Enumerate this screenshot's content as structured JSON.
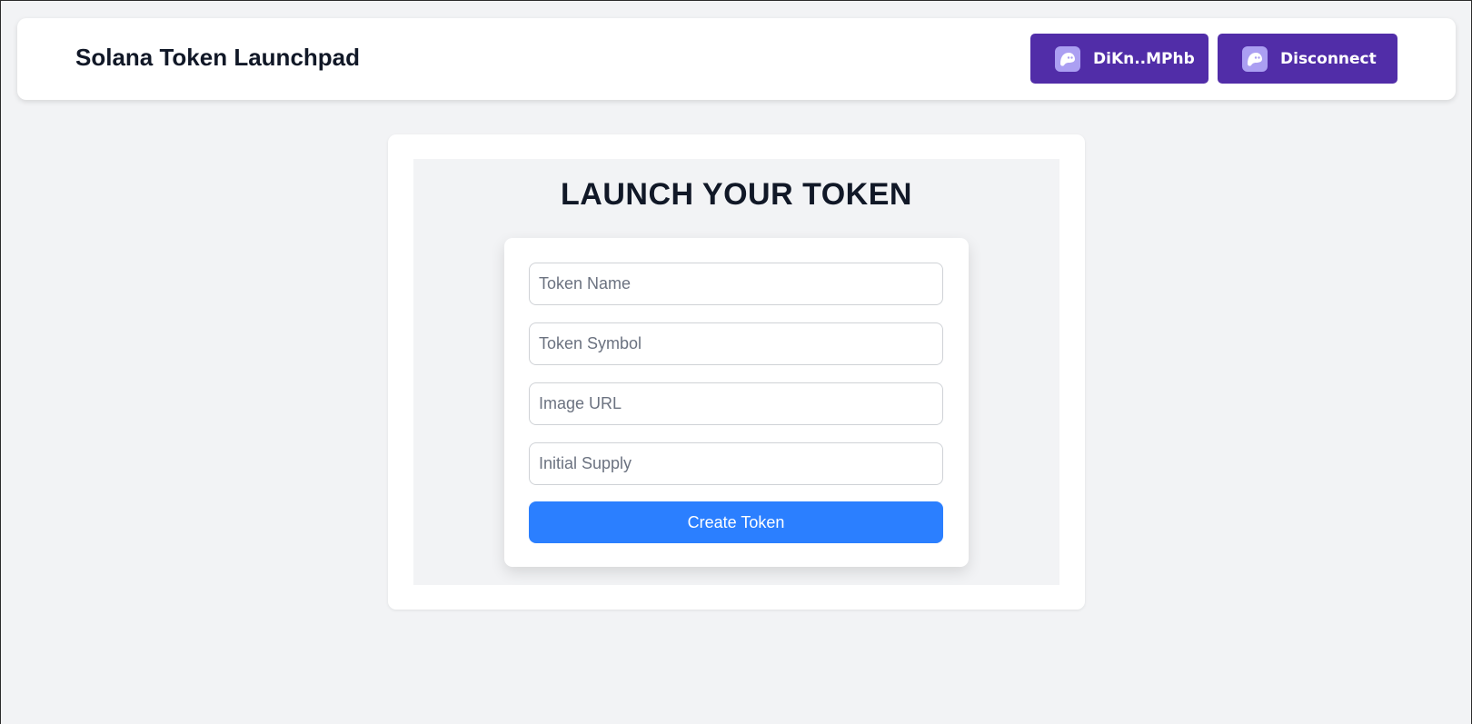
{
  "header": {
    "title": "Solana Token Launchpad",
    "wallet_address_label": "DiKn..MPhb",
    "disconnect_label": "Disconnect",
    "wallet_icon": "phantom-ghost-icon",
    "wallet_button_color": "#512da8"
  },
  "main": {
    "heading": "LAUNCH YOUR TOKEN",
    "form": {
      "token_name_placeholder": "Token Name",
      "token_symbol_placeholder": "Token Symbol",
      "image_url_placeholder": "Image URL",
      "initial_supply_placeholder": "Initial Supply",
      "submit_label": "Create Token",
      "submit_color": "#2b7fff"
    }
  }
}
